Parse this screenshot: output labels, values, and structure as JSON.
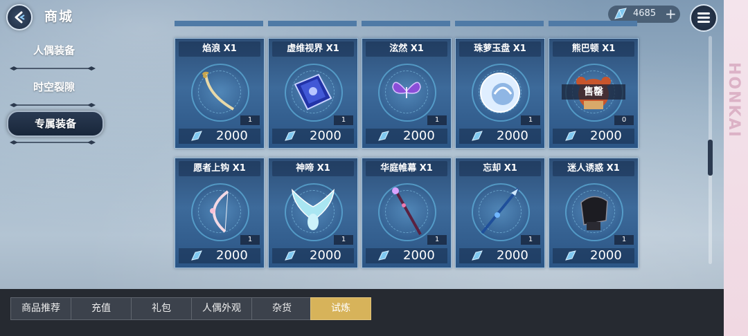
{
  "header": {
    "title": "商城",
    "currency_amount": "4685",
    "add_label": "+"
  },
  "sidebar": {
    "items": [
      {
        "label": "人偶装备",
        "active": false
      },
      {
        "label": "时空裂隙",
        "active": false
      },
      {
        "label": "专属装备",
        "active": true
      }
    ]
  },
  "items": [
    {
      "name": "焰浪 X1",
      "count": "1",
      "price": "2000",
      "icon": "saber-icon"
    },
    {
      "name": "虚维视界 X1",
      "count": "1",
      "price": "2000",
      "icon": "tablet-icon"
    },
    {
      "name": "泫然 X1",
      "count": "1",
      "price": "2000",
      "icon": "butterfly-icon"
    },
    {
      "name": "珠萝玉盘 X1",
      "count": "1",
      "price": "2000",
      "icon": "shell-icon"
    },
    {
      "name": "熊巴顿 X1",
      "count": "0",
      "price": "2000",
      "icon": "bear-icon",
      "sold_label": "售罄"
    },
    {
      "name": "愿者上钩 X1",
      "count": "1",
      "price": "2000",
      "icon": "bow-icon"
    },
    {
      "name": "神啼 X1",
      "count": "1",
      "price": "2000",
      "icon": "bird-icon"
    },
    {
      "name": "华庭帷幕 X1",
      "count": "1",
      "price": "2000",
      "icon": "staff-icon"
    },
    {
      "name": "忘却 X1",
      "count": "1",
      "price": "2000",
      "icon": "spear-icon"
    },
    {
      "name": "迷人诱惑 X1",
      "count": "1",
      "price": "2000",
      "icon": "gauntlet-icon"
    }
  ],
  "tabs": [
    {
      "label": "商品推荐"
    },
    {
      "label": "充值"
    },
    {
      "label": "礼包"
    },
    {
      "label": "人偶外观"
    },
    {
      "label": "杂货"
    },
    {
      "label": "试炼",
      "active": true
    }
  ],
  "side_strip_text": "HONKAI",
  "colors": {
    "active_tab": "#d7b35a",
    "card_bg": "#3d6a9a",
    "gem": "#7fc8f0"
  }
}
